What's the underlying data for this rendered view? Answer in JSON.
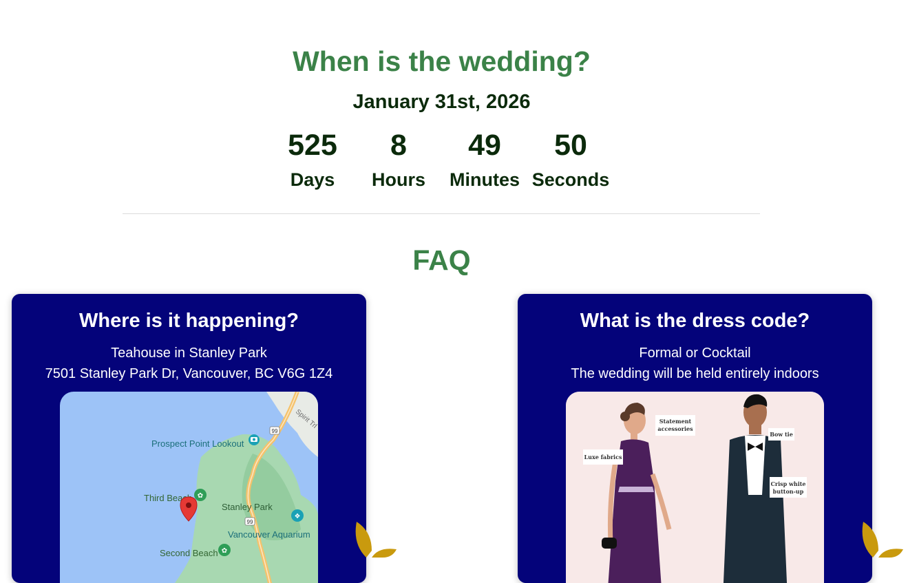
{
  "countdown_section": {
    "title": "When is the wedding?",
    "date": "January 31st, 2026",
    "units": [
      {
        "value": "525",
        "label": "Days"
      },
      {
        "value": "8",
        "label": "Hours"
      },
      {
        "value": "49",
        "label": "Minutes"
      },
      {
        "value": "50",
        "label": "Seconds"
      }
    ]
  },
  "faq": {
    "title": "FAQ",
    "cards": [
      {
        "question": "Where is it happening?",
        "line1": "Teahouse in Stanley Park",
        "line2": "7501 Stanley Park Dr, Vancouver, BC V6G 1Z4",
        "map_labels": {
          "prospect": "Prospect Point Lookout",
          "third_beach": "Third Beach",
          "stanley_park": "Stanley Park",
          "aquarium": "Vancouver Aquarium",
          "second_beach": "Second Beach",
          "spirit_trail": "Spirit Trl",
          "highway_99": "99"
        }
      },
      {
        "question": "What is the dress code?",
        "line1": "Formal or Cocktail",
        "line2": "The wedding will be held entirely indoors",
        "illustration_labels": {
          "statement": "Statement accessories",
          "luxe": "Luxe fabrics",
          "bowtie": "Bow tie",
          "crisp": "Crisp white button-up"
        }
      }
    ]
  },
  "colors": {
    "heading_green": "#3b8248",
    "text_dark": "#0b2a0b",
    "card_navy": "#04037a",
    "leaf_gold": "#c99a0e"
  }
}
